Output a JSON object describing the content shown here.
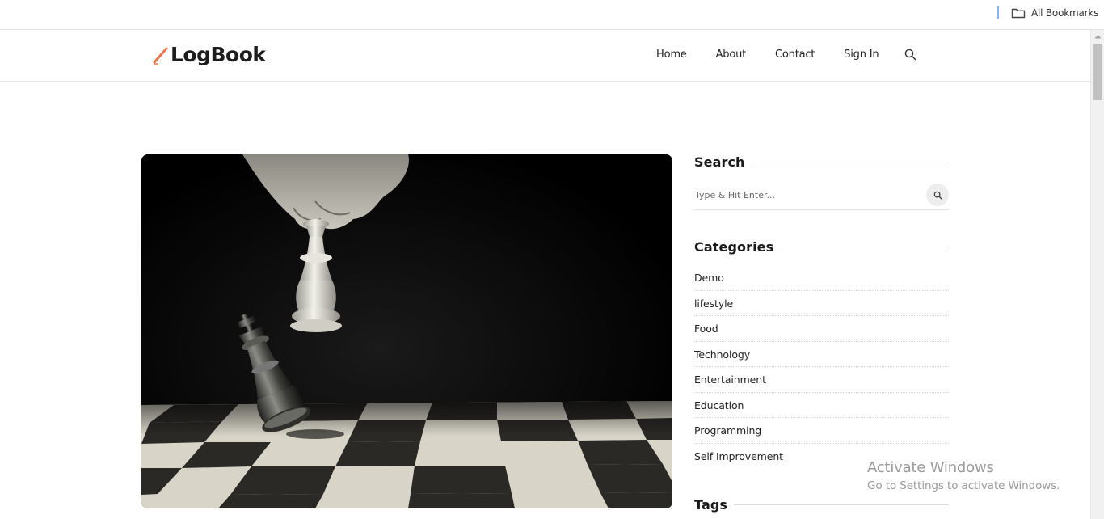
{
  "browser": {
    "bookmarks_label": "All Bookmarks"
  },
  "site": {
    "logo_text": "LogBook",
    "accent_color": "#e8744f",
    "nav": {
      "home": "Home",
      "about": "About",
      "contact": "Contact",
      "sign_in": "Sign In"
    }
  },
  "sidebar": {
    "search_title": "Search",
    "search_placeholder": "Type & Hit Enter...",
    "categories_title": "Categories",
    "categories": [
      "Demo",
      "lifestyle",
      "Food",
      "Technology",
      "Entertainment",
      "Education",
      "Programming",
      "Self Improvement"
    ],
    "tags_title": "Tags"
  },
  "watermark": {
    "line1": "Activate Windows",
    "line2": "Go to Settings to activate Windows."
  }
}
